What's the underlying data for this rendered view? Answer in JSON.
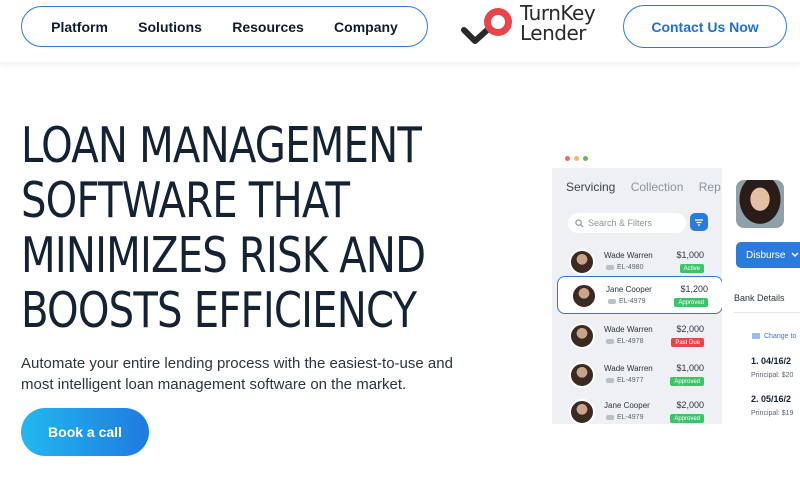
{
  "nav": {
    "items": [
      "Platform",
      "Solutions",
      "Resources",
      "Company"
    ],
    "contact_label": "Contact Us Now"
  },
  "logo": {
    "line1": "TurnKey",
    "line2": "Lender"
  },
  "hero": {
    "title_lines": [
      "LOAN MANAGEMENT",
      "SOFTWARE THAT",
      "MINIMIZES RISK AND",
      "BOOSTS EFFICIENCY"
    ],
    "subtitle_line1": "Automate your entire lending process with the easiest-to-use and",
    "subtitle_line2": "most intelligent loan management software on the market.",
    "cta_label": "Book a call"
  },
  "app_mock": {
    "tabs": [
      "Servicing",
      "Collection",
      "Rep"
    ],
    "search_placeholder": "Search & Filters",
    "loans": [
      {
        "name": "Wade Warren",
        "id": "EL-4980",
        "amount": "$1,000",
        "status": "Active",
        "status_color": "#3cc46a"
      },
      {
        "name": "Jane Cooper",
        "id": "EL-4979",
        "amount": "$1,200",
        "status": "Approved",
        "status_color": "#3cc46a",
        "selected": true
      },
      {
        "name": "Wade Warren",
        "id": "EL-4978",
        "amount": "$2,000",
        "status": "Past Due",
        "status_color": "#e8454a"
      },
      {
        "name": "Wade Warren",
        "id": "EL-4977",
        "amount": "$1,000",
        "status": "Approved",
        "status_color": "#3cc46a"
      },
      {
        "name": "Jane Cooper",
        "id": "EL-4979",
        "amount": "$2,000",
        "status": "Approved",
        "status_color": "#3cc46a"
      }
    ],
    "detail": {
      "disburse_label": "Disburse",
      "bank_details_label": "Bank Details",
      "change_label": "Change to",
      "payments": [
        {
          "label": "1.  04/16/2",
          "principal": "Principal: $20"
        },
        {
          "label": "2.  05/16/2",
          "principal": "Principal: $19"
        }
      ]
    }
  },
  "colors": {
    "accent": "#2b7bdc",
    "heading": "#142233",
    "cta_start": "#22b8f0",
    "cta_end": "#1f7ae0"
  }
}
